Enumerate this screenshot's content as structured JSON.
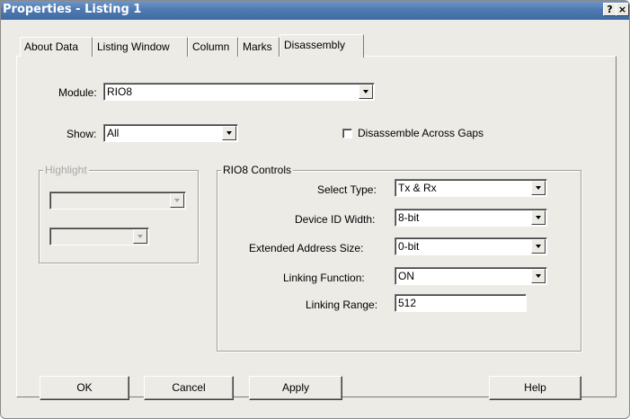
{
  "window": {
    "title": "Properties - Listing 1",
    "help_glyph": "?",
    "close_glyph": "×"
  },
  "tabs": [
    {
      "label": "About Data"
    },
    {
      "label": "Listing Window"
    },
    {
      "label": "Column"
    },
    {
      "label": "Marks"
    },
    {
      "label": "Disassembly",
      "active": true
    }
  ],
  "form": {
    "module_label": "Module:",
    "module_value": "RIO8",
    "show_label": "Show:",
    "show_value": "All",
    "disassemble_gaps_label": "Disassemble Across Gaps",
    "disassemble_gaps_checked": false
  },
  "highlight": {
    "title": "Highlight",
    "enabled": false
  },
  "controls": {
    "title": "RIO8 Controls",
    "select_type_label": "Select Type:",
    "select_type_value": "Tx & Rx",
    "device_id_width_label": "Device ID Width:",
    "device_id_width_value": "8-bit",
    "extended_address_size_label": "Extended Address Size:",
    "extended_address_size_value": "0-bit",
    "linking_function_label": "Linking Function:",
    "linking_function_value": "ON",
    "linking_range_label": "Linking Range:",
    "linking_range_value": "512"
  },
  "buttons": {
    "ok": "OK",
    "cancel": "Cancel",
    "apply": "Apply",
    "help": "Help"
  }
}
